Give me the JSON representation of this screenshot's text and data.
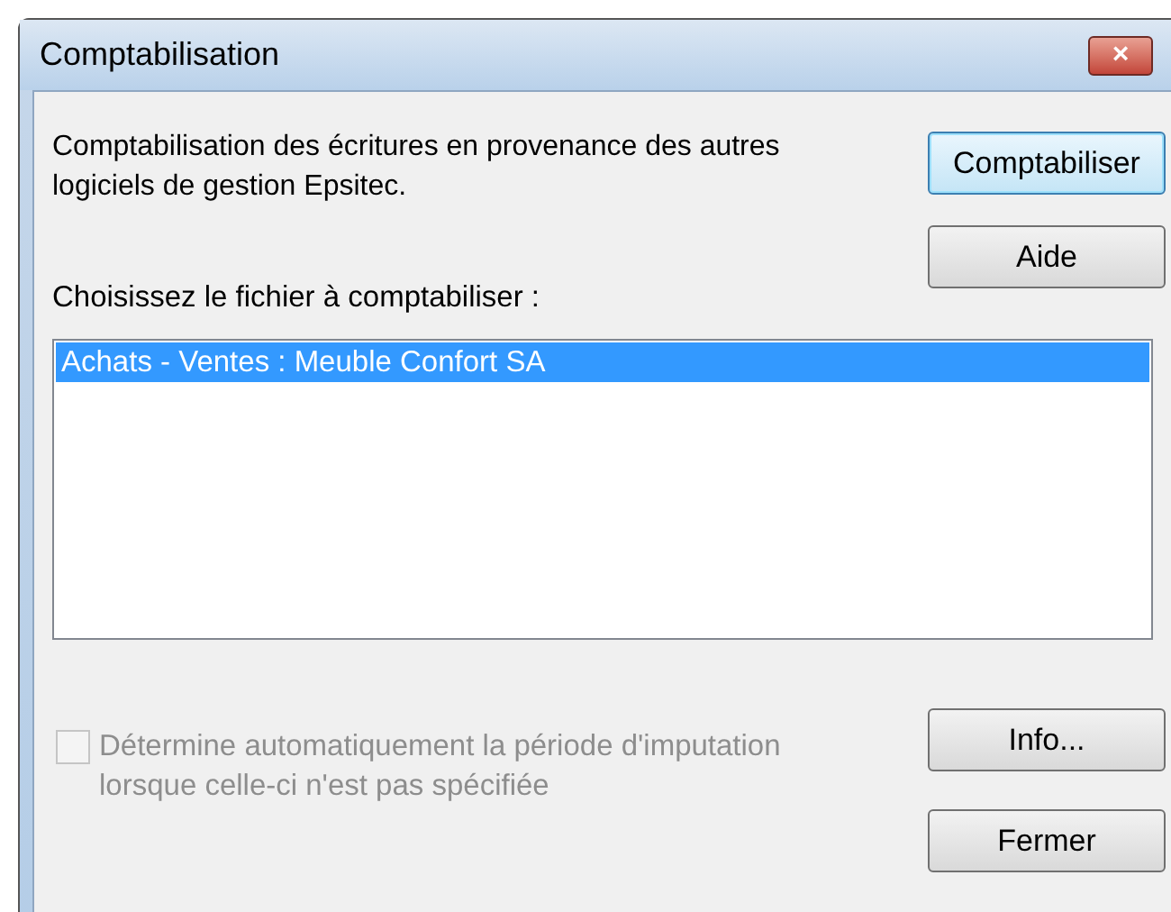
{
  "window": {
    "title": "Comptabilisation",
    "close": "×"
  },
  "description": "Comptabilisation des écritures en provenance des autres logiciels de gestion Epsitec.",
  "buttons_top": [
    {
      "label": "Comptabiliser",
      "default": true
    },
    {
      "label": "Aide",
      "default": false
    }
  ],
  "file_label": "Choisissez le fichier à comptabiliser :",
  "files": [
    {
      "label": "Achats - Ventes : Meuble Confort SA",
      "selected": true
    }
  ],
  "auto_period": {
    "label": "Détermine automatiquement la période d'imputation lorsque celle-ci n'est pas spécifiée",
    "checked": false,
    "disabled": true
  },
  "buttons_bottom": [
    {
      "label": "Info...",
      "default": false
    },
    {
      "label": "Fermer",
      "default": false
    }
  ]
}
